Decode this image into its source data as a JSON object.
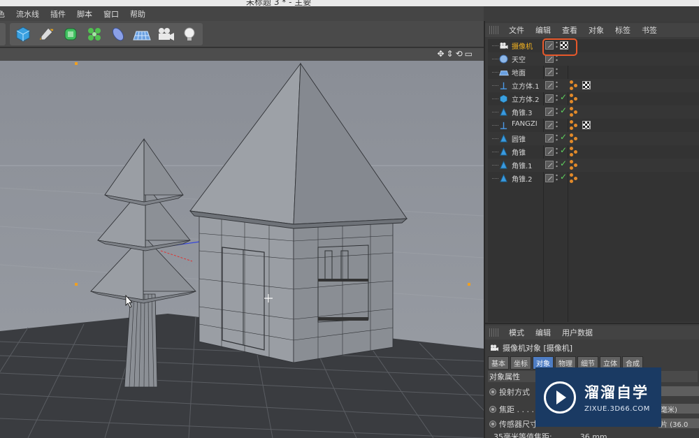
{
  "window": {
    "title": "未标题 3 * - 主要"
  },
  "menubar": {
    "items": [
      "色",
      "流水线",
      "插件",
      "脚本",
      "窗口",
      "帮助"
    ]
  },
  "toolbar": {
    "tools": [
      {
        "name": "cube-icon",
        "color": "#3aa0e0"
      },
      {
        "name": "pen-spline-icon",
        "color": "#e0a020"
      },
      {
        "name": "subdivision-icon",
        "color": "#40c060"
      },
      {
        "name": "cloner-icon",
        "color": "#50c050"
      },
      {
        "name": "deformer-icon",
        "color": "#8aa0e8"
      },
      {
        "name": "floor-icon",
        "color": "#6aa0e0"
      },
      {
        "name": "camera-icon",
        "color": "#e8e8e8"
      },
      {
        "name": "light-icon",
        "color": "#f0f0f0"
      }
    ]
  },
  "viewport": {
    "nav_icons": [
      "✥",
      "⇕",
      "⟲",
      "▭"
    ]
  },
  "object_manager": {
    "menu": [
      "文件",
      "编辑",
      "查看",
      "对象",
      "标签",
      "书签"
    ],
    "objects": [
      {
        "name": "摄像机",
        "icon": "camera-icon",
        "highlight": true,
        "check": false,
        "tags": [
          "target-tag"
        ]
      },
      {
        "name": "天空",
        "icon": "sky-icon",
        "highlight": false,
        "check": false,
        "tags": []
      },
      {
        "name": "地面",
        "icon": "floor-icon",
        "highlight": false,
        "check": false,
        "tags": []
      },
      {
        "name": "立方体.1",
        "icon": "null-icon",
        "highlight": false,
        "check": false,
        "tags": [
          "phong",
          "checker"
        ]
      },
      {
        "name": "立方体.2",
        "icon": "cube-icon",
        "highlight": false,
        "check": true,
        "tags": [
          "phong"
        ]
      },
      {
        "name": "角锥.3",
        "icon": "cone-icon",
        "highlight": false,
        "check": true,
        "tags": [
          "phong"
        ]
      },
      {
        "name": "FANGZI",
        "icon": "null-icon",
        "highlight": false,
        "check": false,
        "tags": [
          "phong",
          "checker"
        ]
      },
      {
        "name": "圆锥",
        "icon": "cone-icon",
        "highlight": false,
        "check": true,
        "tags": [
          "phong"
        ]
      },
      {
        "name": "角锥",
        "icon": "cone-icon",
        "highlight": false,
        "check": true,
        "tags": [
          "phong"
        ]
      },
      {
        "name": "角锥.1",
        "icon": "cone-icon",
        "highlight": false,
        "check": true,
        "tags": [
          "phong"
        ]
      },
      {
        "name": "角锥.2",
        "icon": "cone-icon",
        "highlight": false,
        "check": true,
        "tags": [
          "phong"
        ]
      }
    ]
  },
  "attributes": {
    "menu": [
      "模式",
      "编辑",
      "用户数据"
    ],
    "header": "摄像机对象 [摄像机]",
    "tabs": [
      "基本",
      "坐标",
      "对象",
      "物理",
      "细节",
      "立体",
      "合成"
    ],
    "active_tab": "对象",
    "section": "对象属性",
    "props": [
      {
        "label": "投射方式",
        "value": ""
      },
      {
        "label": "焦距 . . . . . . . .",
        "value": "毫米)"
      },
      {
        "label": "传感器尺寸",
        "value": "片 (36.0"
      },
      {
        "label": "35毫米等值焦距:",
        "value": "36 mm"
      }
    ]
  },
  "watermark": {
    "cn": "溜溜自学",
    "en": "ZIXUE.3D66.COM"
  },
  "colors": {
    "highlight_box": "#e8582a",
    "active_tab": "#4e7dc4",
    "camera_name": "#f0b020"
  }
}
